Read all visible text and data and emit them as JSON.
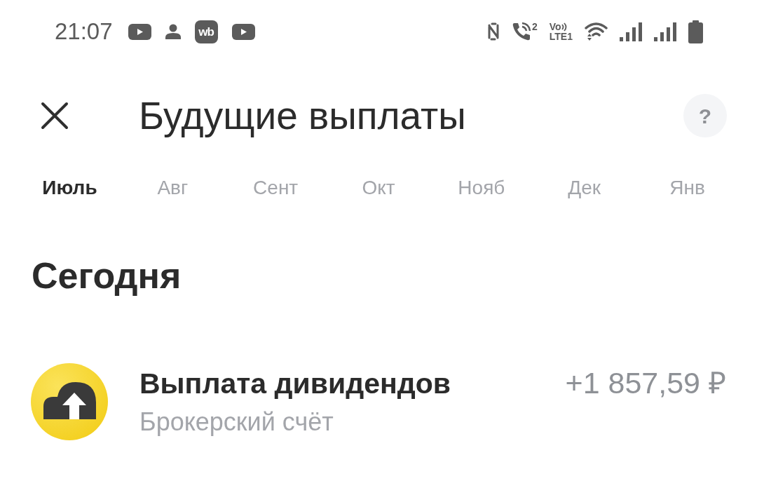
{
  "status_bar": {
    "time": "21:07",
    "notifications": [
      {
        "kind": "video"
      },
      {
        "kind": "person"
      },
      {
        "kind": "app",
        "label": "wb"
      },
      {
        "kind": "video"
      }
    ],
    "indicators": [
      {
        "kind": "nfc"
      },
      {
        "kind": "call",
        "label": "2"
      },
      {
        "kind": "volte",
        "label": "Vo",
        "sublabel": "LTE1"
      },
      {
        "kind": "wifi"
      },
      {
        "kind": "signal"
      },
      {
        "kind": "signal"
      },
      {
        "kind": "battery"
      }
    ]
  },
  "header": {
    "title": "Будущие выплаты",
    "help_label": "?"
  },
  "months": [
    {
      "label": "Июль",
      "selected": true
    },
    {
      "label": "Авг",
      "selected": false
    },
    {
      "label": "Сент",
      "selected": false
    },
    {
      "label": "Окт",
      "selected": false
    },
    {
      "label": "Нояб",
      "selected": false
    },
    {
      "label": "Дек",
      "selected": false
    },
    {
      "label": "Янв",
      "selected": false
    }
  ],
  "sections": [
    {
      "heading": "Сегодня",
      "items": [
        {
          "title": "Выплата дивидендов",
          "subtitle": "Брокерский счёт",
          "amount": "+1 857,59 ₽"
        }
      ]
    }
  ]
}
